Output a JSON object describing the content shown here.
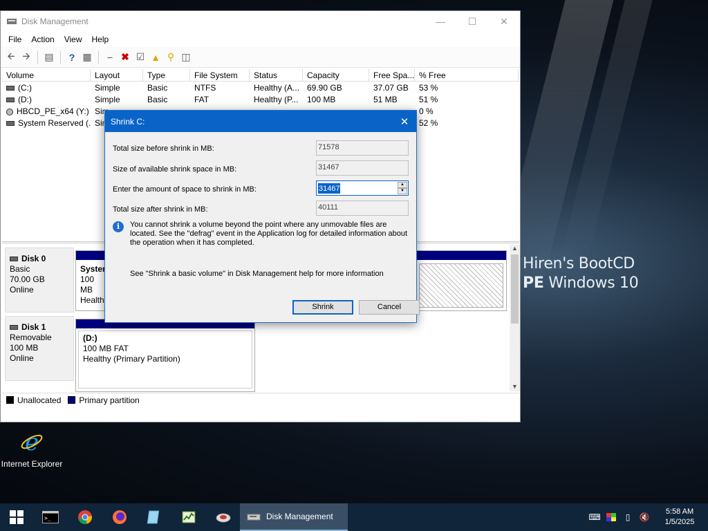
{
  "desktop": {
    "wallpaper_text_line1": "Hiren's BootCD",
    "wallpaper_text_pe": "PE",
    "wallpaper_text_rest": " Windows 10",
    "icons": [
      {
        "label": "Internet Explorer",
        "icon": "internet-explorer-icon"
      }
    ]
  },
  "disk_management": {
    "title": "Disk Management",
    "menu": [
      "File",
      "Action",
      "View",
      "Help"
    ],
    "columns": [
      "Volume",
      "Layout",
      "Type",
      "File System",
      "Status",
      "Capacity",
      "Free Spa...",
      "% Free"
    ],
    "rows": [
      {
        "volume": "(C:)",
        "layout": "Simple",
        "type": "Basic",
        "fs": "NTFS",
        "status": "Healthy (A...",
        "capacity": "69.90 GB",
        "free": "37.07 GB",
        "pct": "53 %"
      },
      {
        "volume": "(D:)",
        "layout": "Simple",
        "type": "Basic",
        "fs": "FAT",
        "status": "Healthy (P...",
        "capacity": "100 MB",
        "free": "51 MB",
        "pct": "51 %"
      },
      {
        "volume": "HBCD_PE_x64 (Y:)",
        "layout": "Sim",
        "type": "",
        "fs": "",
        "status": "",
        "capacity": "",
        "free": "",
        "pct": "0 %"
      },
      {
        "volume": "System Reserved (...",
        "layout": "Sim",
        "type": "",
        "fs": "",
        "status": "",
        "capacity": "",
        "free": "",
        "pct": "52 %"
      }
    ],
    "disks": [
      {
        "name": "Disk 0",
        "kind": "Basic",
        "size": "70.00 GB",
        "state": "Online",
        "partition": {
          "title": "System",
          "line2": "100 MB",
          "line3": "Healthy"
        }
      },
      {
        "name": "Disk 1",
        "kind": "Removable",
        "size": "100 MB",
        "state": "Online",
        "partition": {
          "title": "(D:)",
          "line2": "100 MB FAT",
          "line3": "Healthy (Primary Partition)"
        }
      }
    ],
    "legend": [
      {
        "label": "Unallocated",
        "color": "#000000"
      },
      {
        "label": "Primary partition",
        "color": "#00007f"
      }
    ]
  },
  "shrink_dialog": {
    "title": "Shrink C:",
    "fields": [
      {
        "label": "Total size before shrink in MB:",
        "value": "71578"
      },
      {
        "label": "Size of available shrink space in MB:",
        "value": "31467"
      },
      {
        "label": "Enter the amount of space to shrink in MB:",
        "value": "31467"
      },
      {
        "label": "Total size after shrink in MB:",
        "value": "40111"
      }
    ],
    "info": "You cannot shrink a volume beyond the point where any unmovable files are located. See the \"defrag\" event in the Application log for detailed information about the operation when it has completed.",
    "help": "See \"Shrink a basic volume\" in Disk Management help for more information",
    "shrink_label": "Shrink",
    "cancel_label": "Cancel"
  },
  "taskbar": {
    "active_task": "Disk Management",
    "time": "5:58 AM",
    "date": "1/5/2025"
  },
  "colors": {
    "accent": "#0a64c8",
    "taskbar": "#10243a",
    "primary_partition": "#00007f"
  }
}
